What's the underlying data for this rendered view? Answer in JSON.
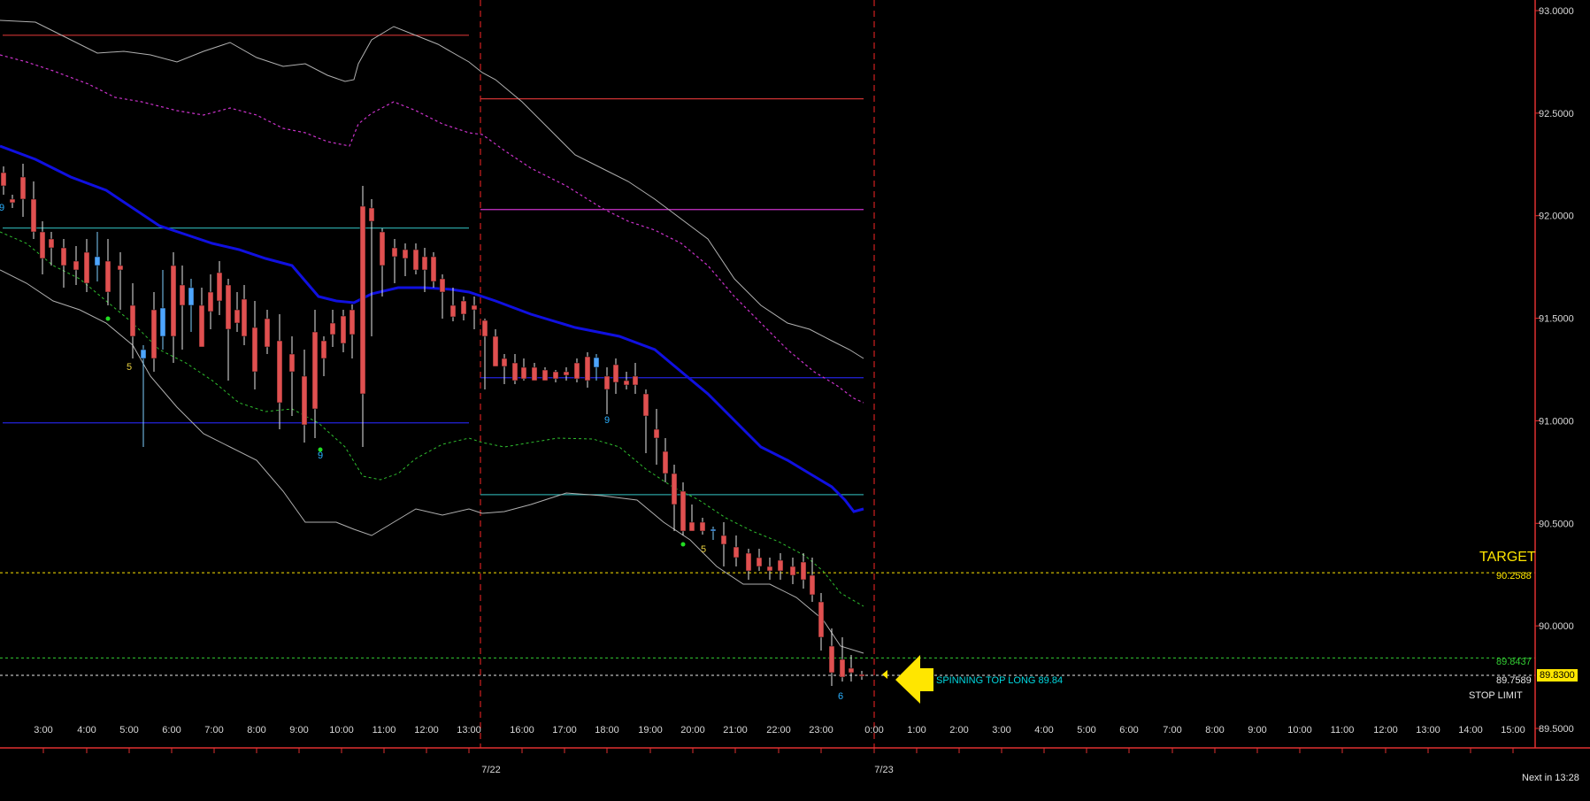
{
  "chart_data": {
    "type": "candlestick",
    "title": "",
    "price_axis": {
      "min": 89.5,
      "max": 93.0,
      "ticks": [
        "93.0000",
        "92.5000",
        "92.0000",
        "91.5000",
        "91.0000",
        "90.5000",
        "90.0000",
        "89.5000"
      ]
    },
    "time_axis": {
      "ticks": [
        "3:00",
        "4:00",
        "5:00",
        "6:00",
        "7:00",
        "8:00",
        "9:00",
        "10:00",
        "11:00",
        "12:00",
        "13:00",
        "16:00",
        "17:00",
        "18:00",
        "19:00",
        "20:00",
        "21:00",
        "22:00",
        "23:00",
        "0:00",
        "1:00",
        "2:00",
        "3:00",
        "4:00",
        "5:00",
        "6:00",
        "7:00",
        "8:00",
        "9:00",
        "10:00",
        "11:00",
        "12:00",
        "13:00",
        "14:00",
        "15:00"
      ],
      "date_labels": [
        "7/22",
        "7/23"
      ],
      "session_breaks": [
        "13:00",
        "0:00"
      ]
    },
    "levels": {
      "target": {
        "label": "TARGET",
        "value": "90.2588",
        "color": "#ffe600"
      },
      "entry": {
        "value": "89.8437",
        "color": "#33cc33"
      },
      "stop": {
        "label": "STOP LIMIT",
        "value": "89.7589",
        "color": "#e8e8e8"
      },
      "current_price": {
        "value": "89.8300",
        "color": "#ffe600"
      }
    },
    "signal": {
      "text": "SPINNING TOP LONG  89.84",
      "color": "#00d8e0"
    },
    "footer": {
      "text": "Next in 13:28"
    },
    "count_labels": [
      {
        "time": "2:00",
        "value": "9"
      },
      {
        "time": "5:00",
        "value": "5"
      },
      {
        "time": "9:30",
        "value": "9"
      },
      {
        "time": "18:00",
        "value": "9"
      },
      {
        "time": "20:15",
        "value": "5"
      },
      {
        "time": "23:30",
        "value": "6"
      }
    ],
    "colors": {
      "up": "#4da6ff",
      "down": "#e05050",
      "sma": "#1010e0",
      "band": "#b0b0b0"
    },
    "grid": false
  }
}
